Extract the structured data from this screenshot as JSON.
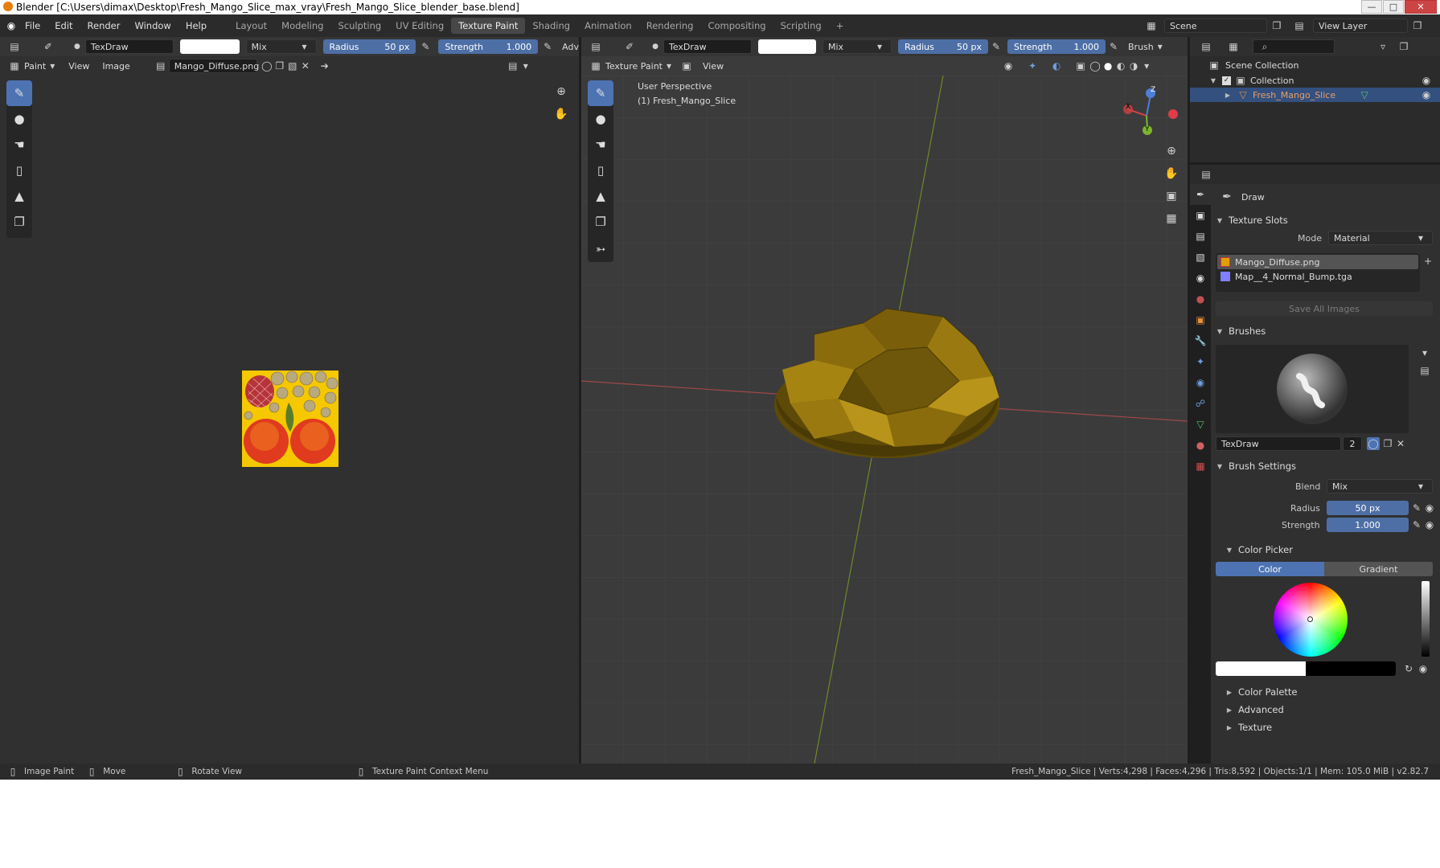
{
  "window": {
    "title": "Blender [C:\\Users\\dimax\\Desktop\\Fresh_Mango_Slice_max_vray\\Fresh_Mango_Slice_blender_base.blend]"
  },
  "menu": [
    "File",
    "Edit",
    "Render",
    "Window",
    "Help"
  ],
  "workspaces": [
    "Layout",
    "Modeling",
    "Sculpting",
    "UV Editing",
    "Texture Paint",
    "Shading",
    "Animation",
    "Rendering",
    "Compositing",
    "Scripting"
  ],
  "active_workspace": "Texture Paint",
  "scene": {
    "label": "Scene",
    "view_layer": "View Layer"
  },
  "image_editor": {
    "brush_name": "TexDraw",
    "blend": "Mix",
    "radius_label": "Radius",
    "radius_value": "50 px",
    "strength_label": "Strength",
    "strength_value": "1.000",
    "adv": "Adv",
    "mode": "Paint",
    "menus": [
      "View",
      "Image"
    ],
    "image_name": "Mango_Diffuse.png"
  },
  "viewport": {
    "brush_name": "TexDraw",
    "blend": "Mix",
    "radius_label": "Radius",
    "radius_value": "50 px",
    "strength_label": "Strength",
    "strength_value": "1.000",
    "brush_menu": "Brush",
    "mode": "Texture Paint",
    "view_menu": "View",
    "overlay_line1": "User Perspective",
    "overlay_line2": "(1) Fresh_Mango_Slice",
    "gizmo": {
      "x": "X",
      "y": "Y",
      "z": "Z"
    }
  },
  "outliner": {
    "root": "Scene Collection",
    "collection": "Collection",
    "object": "Fresh_Mango_Slice"
  },
  "properties": {
    "tool_name": "Draw",
    "texture_slots": {
      "header": "Texture Slots",
      "mode_label": "Mode",
      "mode_value": "Material",
      "slots": [
        "Mango_Diffuse.png",
        "Map__4_Normal_Bump.tga"
      ],
      "save_all": "Save All Images"
    },
    "brushes": {
      "header": "Brushes",
      "name": "TexDraw",
      "users": "2"
    },
    "brush_settings": {
      "header": "Brush Settings",
      "blend_label": "Blend",
      "blend_value": "Mix",
      "radius_label": "Radius",
      "radius_value": "50 px",
      "strength_label": "Strength",
      "strength_value": "1.000"
    },
    "color_picker": {
      "header": "Color Picker",
      "tab_color": "Color",
      "tab_gradient": "Gradient"
    },
    "collapsed": [
      "Color Palette",
      "Advanced",
      "Texture"
    ]
  },
  "statusbar": {
    "left": [
      "Image Paint",
      "Move",
      "Rotate View",
      "Texture Paint Context Menu"
    ],
    "right": "Fresh_Mango_Slice | Verts:4,298 | Faces:4,296 | Tris:8,592 | Objects:1/1 | Mem: 105.0 MiB | v2.82.7"
  },
  "colors": {
    "accent": "#4d73b3",
    "slider": "#4d6fa6",
    "bg": "#303030",
    "viewport_bg": "#3a3a3a"
  }
}
